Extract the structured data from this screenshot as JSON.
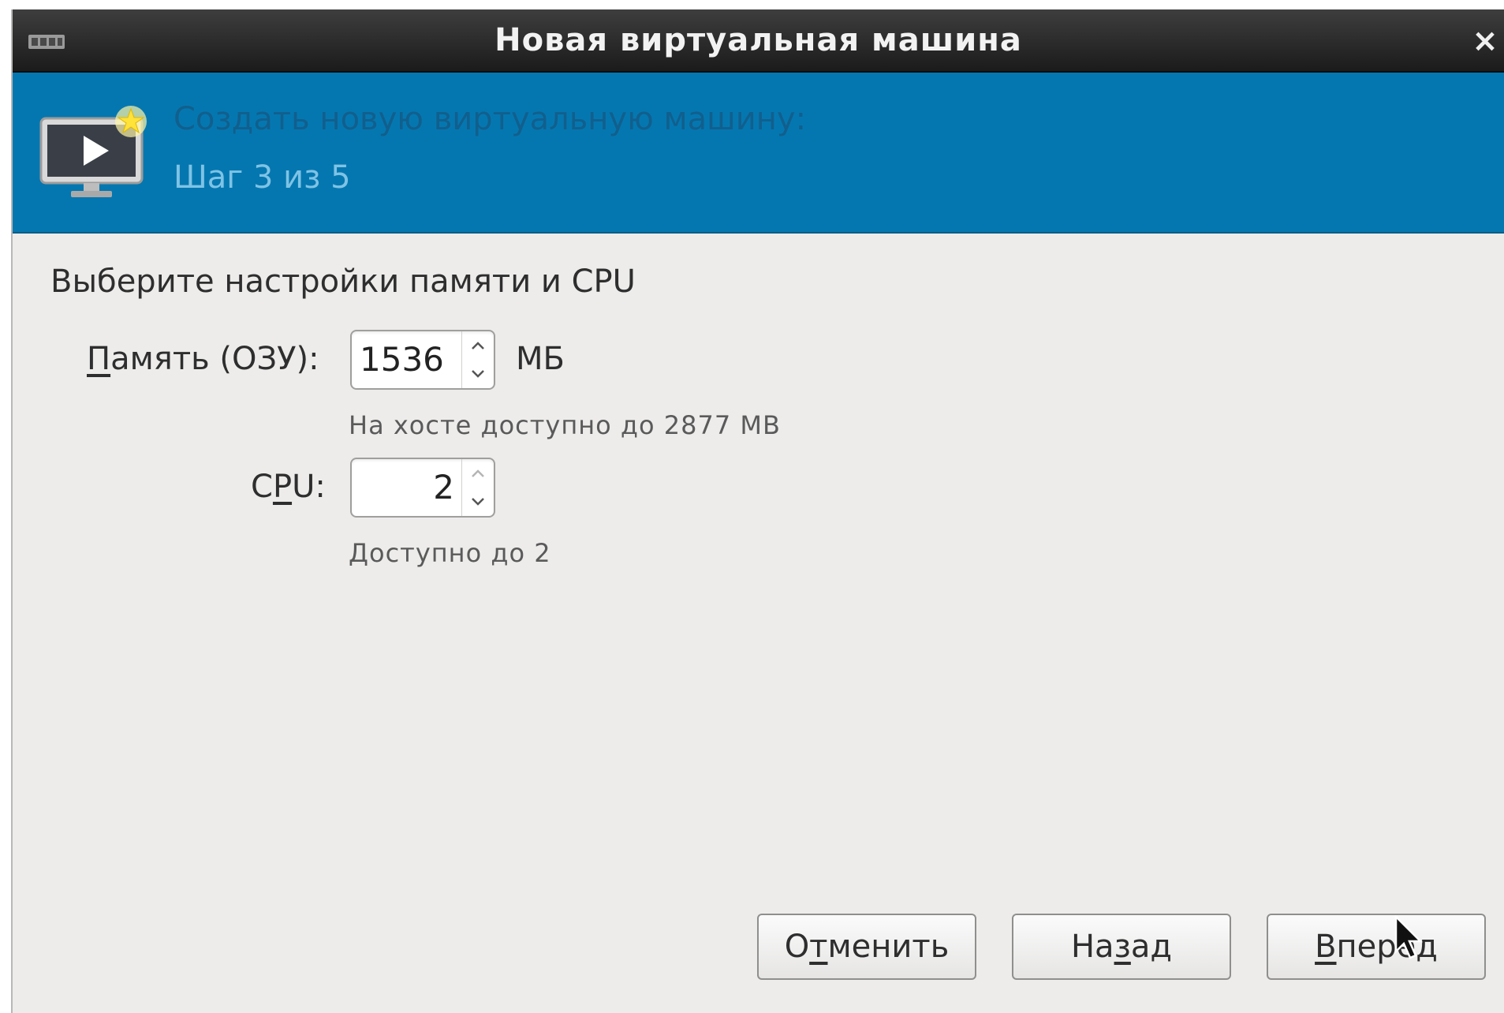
{
  "window": {
    "title": "Новая виртуальная машина",
    "close_glyph": "×"
  },
  "banner": {
    "title": "Создать новую виртуальную машину:",
    "step": "Шаг 3 из 5",
    "icon": "vm-monitor-new-icon"
  },
  "content": {
    "section_title": "Выберите настройки памяти и CPU",
    "memory": {
      "label_mnemonic": "П",
      "label_rest": "амять (ОЗУ):",
      "value": "1536",
      "unit": "МБ",
      "hint": "На хосте доступно до 2877 МВ"
    },
    "cpu": {
      "label_pre": "C",
      "label_mnemonic": "P",
      "label_post": "U:",
      "value": "2",
      "hint": "Доступно до 2"
    }
  },
  "buttons": {
    "cancel": {
      "pre": "О",
      "mnemonic": "т",
      "post": "менить"
    },
    "back": {
      "pre": "На",
      "mnemonic": "з",
      "post": "ад"
    },
    "forward": {
      "pre": "",
      "mnemonic": "В",
      "post": "перёд"
    }
  },
  "colors": {
    "titlebar": "#2b2b2b",
    "banner": "#0577b0",
    "background": "#edeceb"
  }
}
